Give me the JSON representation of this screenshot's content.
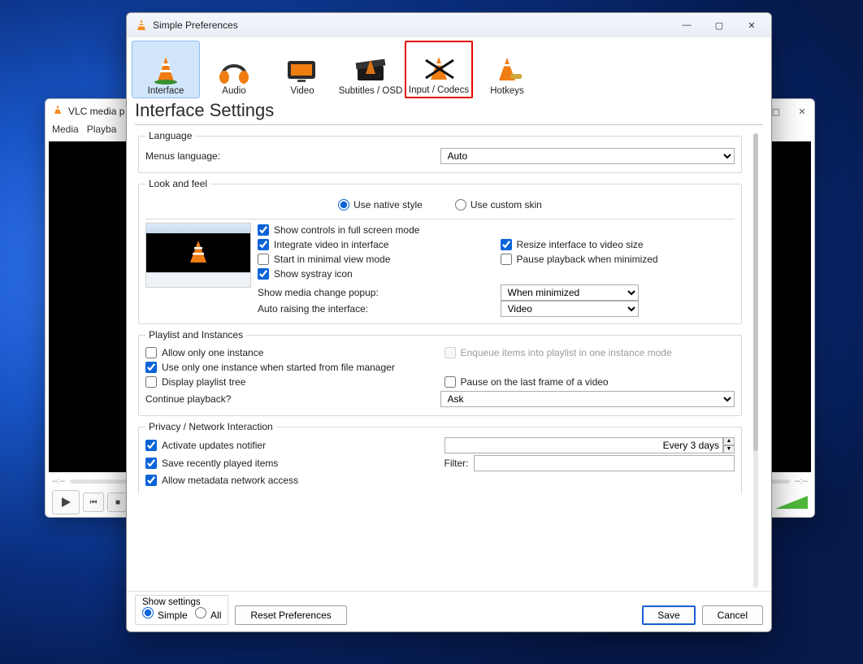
{
  "back_window": {
    "title": "VLC media p",
    "menu": [
      "Media",
      "Playba"
    ],
    "time_left": "--:--",
    "time_right": "--:--"
  },
  "prefs": {
    "window_title": "Simple Preferences",
    "tabs": {
      "interface": "Interface",
      "audio": "Audio",
      "video": "Video",
      "subs": "Subtitles / OSD",
      "input": "Input / Codecs",
      "hotkeys": "Hotkeys"
    },
    "page_title": "Interface Settings",
    "language": {
      "legend": "Language",
      "label": "Menus language:",
      "value": "Auto"
    },
    "look": {
      "legend": "Look and feel",
      "native": "Use native style",
      "custom": "Use custom skin",
      "ctrl_full": "Show controls in full screen mode",
      "integrate": "Integrate video in interface",
      "resize": "Resize interface to video size",
      "min_view": "Start in minimal view mode",
      "pause_min": "Pause playback when minimized",
      "systray": "Show systray icon",
      "popup_label": "Show media change popup:",
      "popup_value": "When minimized",
      "raise_label": "Auto raising the interface:",
      "raise_value": "Video"
    },
    "playlist": {
      "legend": "Playlist and Instances",
      "one_instance": "Allow only one instance",
      "enqueue": "Enqueue items into playlist in one instance mode",
      "one_fm": "Use only one instance when started from file manager",
      "tree": "Display playlist tree",
      "pause_last": "Pause on the last frame of a video",
      "continue_label": "Continue playback?",
      "continue_value": "Ask"
    },
    "privacy": {
      "legend": "Privacy / Network Interaction",
      "updates": "Activate updates notifier",
      "every": "Every 3 days",
      "recent": "Save recently played items",
      "filter": "Filter:",
      "meta": "Allow metadata network access"
    },
    "footer": {
      "show": "Show settings",
      "simple": "Simple",
      "all": "All",
      "reset": "Reset Preferences",
      "save": "Save",
      "cancel": "Cancel"
    }
  }
}
